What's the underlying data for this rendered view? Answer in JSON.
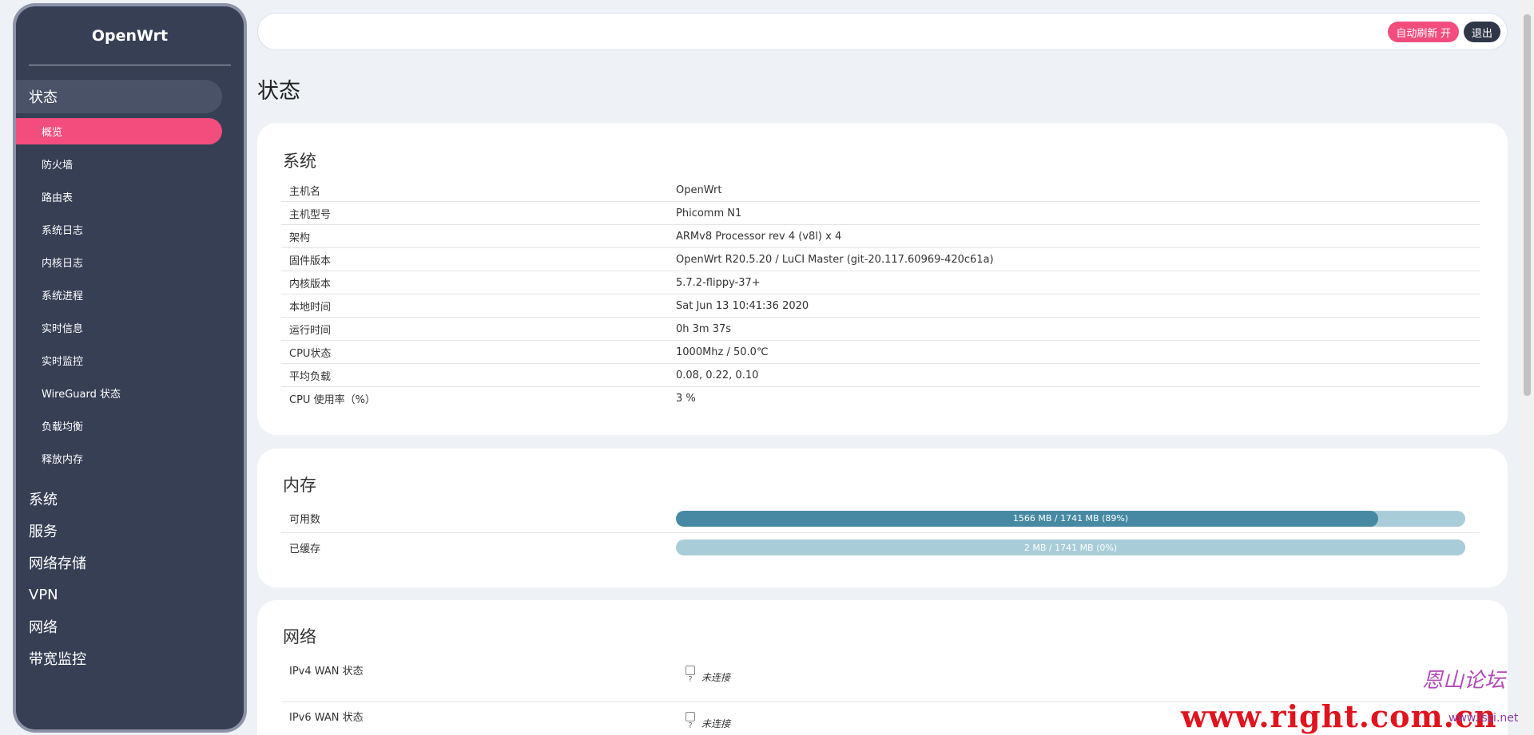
{
  "sidebar": {
    "brand": "OpenWrt",
    "top_item": "状态",
    "sub_items": [
      "概览",
      "防火墙",
      "路由表",
      "系统日志",
      "内核日志",
      "系统进程",
      "实时信息",
      "实时监控",
      "WireGuard 状态",
      "负载均衡",
      "释放内存"
    ],
    "main_items": [
      "系统",
      "服务",
      "网络存储",
      "VPN",
      "网络",
      "带宽监控"
    ]
  },
  "topbar": {
    "refresh_label": "自动刷新 开",
    "logout_label": "退出"
  },
  "page": {
    "title": "状态"
  },
  "system": {
    "title": "系统",
    "rows": [
      {
        "key": "主机名",
        "value": "OpenWrt"
      },
      {
        "key": "主机型号",
        "value": "Phicomm N1"
      },
      {
        "key": "架构",
        "value": "ARMv8 Processor rev 4 (v8l) x 4"
      },
      {
        "key": "固件版本",
        "value": "OpenWrt R20.5.20 / LuCI Master (git-20.117.60969-420c61a)"
      },
      {
        "key": "内核版本",
        "value": "5.7.2-flippy-37+"
      },
      {
        "key": "本地时间",
        "value": "Sat Jun 13 10:41:36 2020"
      },
      {
        "key": "运行时间",
        "value": "0h 3m 37s"
      },
      {
        "key": "CPU状态",
        "value": "1000Mhz / 50.0℃"
      },
      {
        "key": "平均负载",
        "value": "0.08, 0.22, 0.10"
      },
      {
        "key": "CPU 使用率（%）",
        "value": "3 %"
      }
    ]
  },
  "memory": {
    "title": "内存",
    "rows": [
      {
        "key": "可用数",
        "label": "1566 MB / 1741 MB (89%)",
        "percent": 89
      },
      {
        "key": "已缓存",
        "label": "2 MB / 1741 MB (0%)",
        "percent": 0
      }
    ]
  },
  "network": {
    "title": "网络",
    "rows": [
      {
        "key": "IPv4 WAN 状态",
        "status": "未连接",
        "icon_glyph": "?"
      },
      {
        "key": "IPv6 WAN 状态",
        "status": "未连接",
        "icon_glyph": "?"
      }
    ]
  },
  "watermark": {
    "main": "www.right.com.cn",
    "logo": "恩山论坛",
    "small": "www.lszi.net"
  }
}
